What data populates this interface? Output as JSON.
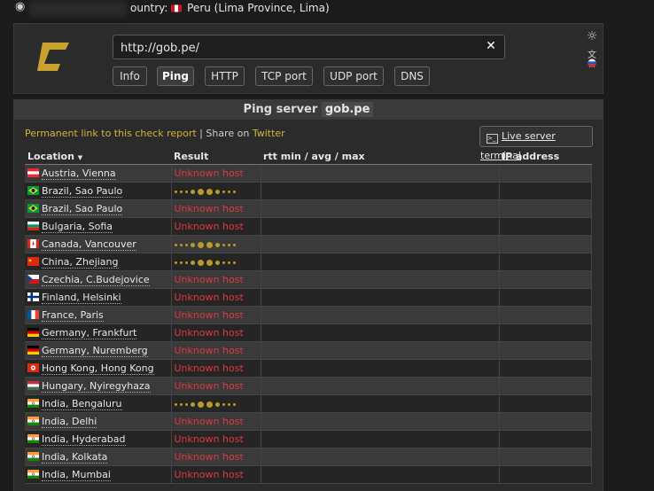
{
  "top": {
    "country_prefix": "ountry:",
    "country": "Peru (Lima Province, Lima)"
  },
  "search": {
    "value": "http://gob.pe/"
  },
  "tabs": [
    "Info",
    "Ping",
    "HTTP",
    "TCP port",
    "UDP port",
    "DNS"
  ],
  "active_tab": "Ping",
  "panel": {
    "title_prefix": "Ping server",
    "host": "gob.pe",
    "permalink": "Permanent link to this check report",
    "share_sep": " | Share on ",
    "twitter": "Twitter",
    "terminal": "Live server terminal"
  },
  "table": {
    "headers": [
      "Location",
      "Result",
      "rtt min / avg / max",
      "IP address"
    ],
    "rows": [
      {
        "flag": "at",
        "location": "Austria, Vienna",
        "result": "Unknown host"
      },
      {
        "flag": "br",
        "location": "Brazil, Sao Paulo",
        "result": "..."
      },
      {
        "flag": "br",
        "location": "Brazil, Sao Paulo",
        "result": "Unknown host"
      },
      {
        "flag": "bg",
        "location": "Bulgaria, Sofia",
        "result": "Unknown host"
      },
      {
        "flag": "ca",
        "location": "Canada, Vancouver",
        "result": "..."
      },
      {
        "flag": "cn",
        "location": "China, Zhejiang",
        "result": "..."
      },
      {
        "flag": "cz",
        "location": "Czechia, C.Budejovice",
        "result": "Unknown host"
      },
      {
        "flag": "fi",
        "location": "Finland, Helsinki",
        "result": "Unknown host"
      },
      {
        "flag": "fr",
        "location": "France, Paris",
        "result": "Unknown host"
      },
      {
        "flag": "de",
        "location": "Germany, Frankfurt",
        "result": "Unknown host"
      },
      {
        "flag": "de",
        "location": "Germany, Nuremberg",
        "result": "Unknown host"
      },
      {
        "flag": "hk",
        "location": "Hong Kong, Hong Kong",
        "result": "Unknown host"
      },
      {
        "flag": "hu",
        "location": "Hungary, Nyiregyhaza",
        "result": "Unknown host"
      },
      {
        "flag": "in",
        "location": "India, Bengaluru",
        "result": "..."
      },
      {
        "flag": "in",
        "location": "India, Delhi",
        "result": "Unknown host"
      },
      {
        "flag": "in",
        "location": "India, Hyderabad",
        "result": "Unknown host"
      },
      {
        "flag": "in",
        "location": "India, Kolkata",
        "result": "Unknown host"
      },
      {
        "flag": "in",
        "location": "India, Mumbai",
        "result": "Unknown host"
      }
    ]
  },
  "colors": {
    "accent": "#d6b23a",
    "error": "#e0383c",
    "logo": "#c9a12f"
  }
}
